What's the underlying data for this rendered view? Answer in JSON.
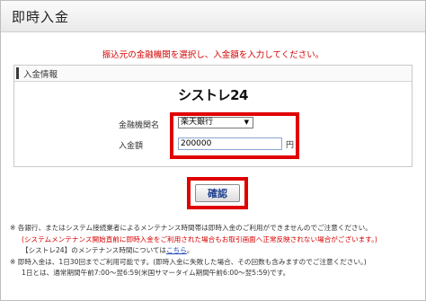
{
  "header": {
    "title": "即時入金"
  },
  "instruction": "振込元の金融機関を選択し、入金額を入力してください。",
  "panel": {
    "header_label": "入金情報",
    "logo_text": "シストレ24",
    "bank_label": "金融機関名",
    "bank_selected": "楽天銀行",
    "amount_label": "入金額",
    "amount_value": "200000",
    "unit": "円"
  },
  "confirm_button": "確認",
  "notes": {
    "mark": "※",
    "line1": "各銀行、またはシステム接続業者によるメンテナンス時間帯は即時入金のご利用ができませんのでご注意ください。",
    "line2": "(システムメンテナンス開始直前に即時入金をご利用された場合もお取引画面へ正常反映されない場合がございます。)",
    "line3_prefix": "【シストレ24】のメンテナンス時間については",
    "line3_link": "こちら",
    "line3_suffix": "。",
    "line4": "即時入金は、1日30回までご利用可能です。(即時入金に失敗した場合、その回数も含みますのでご注意ください。)",
    "line5": "1日とは、通常期間午前7:00〜翌6:59(米国サマータイム期間午前6:00〜翌5:59)です。"
  },
  "colors": {
    "highlight": "#e00000",
    "instruction_text": "#d40000",
    "link": "#1a43b8"
  }
}
